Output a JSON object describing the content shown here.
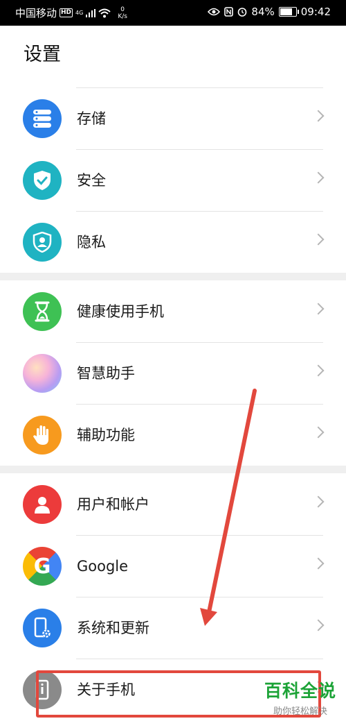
{
  "status_bar": {
    "carrier": "中国移动",
    "hd": "HD",
    "network": "4G",
    "speed_value": "0",
    "speed_unit": "K/s",
    "battery": "84%",
    "battery_level": 0.84,
    "time": "09:42"
  },
  "page": {
    "title": "设置"
  },
  "items": [
    {
      "label": "存储",
      "icon": "storage-icon",
      "color": "#2a7fe8"
    },
    {
      "label": "安全",
      "icon": "shield-check-icon",
      "color": "#1fb3c2"
    },
    {
      "label": "隐私",
      "icon": "privacy-icon",
      "color": "#1fb3c2"
    },
    {
      "label": "健康使用手机",
      "icon": "hourglass-icon",
      "color": "#3ec154"
    },
    {
      "label": "智慧助手",
      "icon": "assistant-icon",
      "color": "#c9a4f0"
    },
    {
      "label": "辅助功能",
      "icon": "hand-icon",
      "color": "#f79a1e"
    },
    {
      "label": "用户和帐户",
      "icon": "user-icon",
      "color": "#ec3b3b"
    },
    {
      "label": "Google",
      "icon": "google-icon",
      "color": "#ffffff"
    },
    {
      "label": "系统和更新",
      "icon": "phone-settings-icon",
      "color": "#2a7fe8"
    },
    {
      "label": "关于手机",
      "icon": "about-phone-icon",
      "color": "#8a8a8a"
    }
  ],
  "watermark": {
    "main": "百科全说",
    "sub": "助你轻松解决"
  },
  "annotation_color": "#e2483d"
}
